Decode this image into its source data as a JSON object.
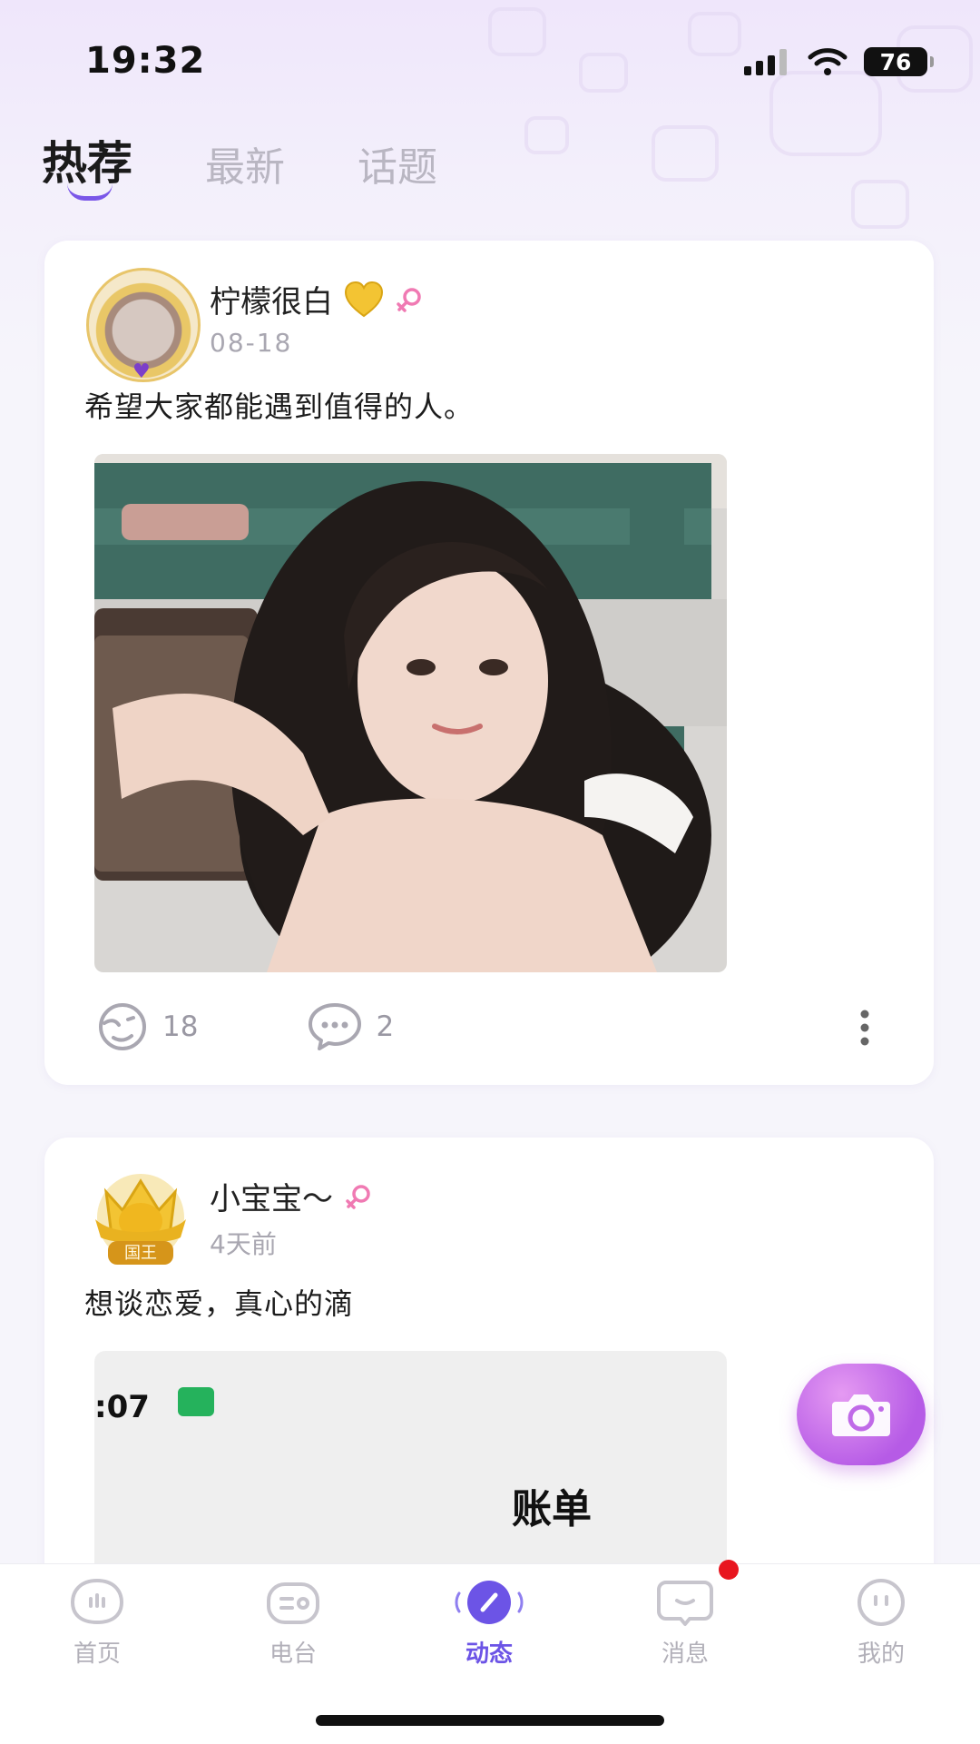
{
  "status_bar": {
    "time": "19:32",
    "battery": "76"
  },
  "tabs": [
    {
      "label": "热荐",
      "active": true
    },
    {
      "label": "最新",
      "active": false
    },
    {
      "label": "话题",
      "active": false
    }
  ],
  "posts": [
    {
      "username": "柠檬很白",
      "date": "08-18",
      "text": "希望大家都能遇到值得的人。",
      "likes": "18",
      "comments": "2"
    },
    {
      "username": "小宝宝～",
      "avatar_badge": "国王",
      "date": "4天前",
      "text": "想谈恋爱，真心的滴",
      "screenshot": {
        "time": ":07",
        "title": "账单"
      }
    }
  ],
  "bottom_nav": [
    {
      "label": "首页",
      "icon": "home-face-icon",
      "active": false
    },
    {
      "label": "电台",
      "icon": "radio-icon",
      "active": false
    },
    {
      "label": "动态",
      "icon": "moments-icon",
      "active": true
    },
    {
      "label": "消息",
      "icon": "message-icon",
      "active": false
    },
    {
      "label": "我的",
      "icon": "profile-icon",
      "active": false
    }
  ],
  "colors": {
    "accent": "#6c54e6",
    "female": "#f07ab3",
    "fab": "#c06ae8",
    "badge": "#e8161f"
  }
}
